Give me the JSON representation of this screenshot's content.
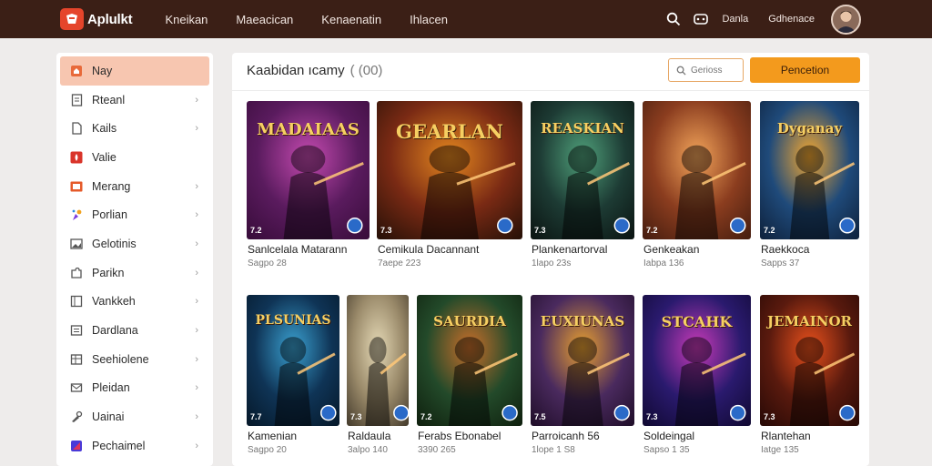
{
  "app": {
    "name": "Aplulkt",
    "colors": {
      "topbar": "#3b1f16",
      "accent": "#f39a1d",
      "brand": "#e5452b",
      "active_bg": "#f7c6b0"
    }
  },
  "nav": {
    "items": [
      "Kneikan",
      "Maeacican",
      "Kenaenatin",
      "Ihlacen"
    ]
  },
  "header": {
    "links": [
      "Danla",
      "Gdhenace"
    ],
    "icons": [
      "search-icon",
      "gamepad-icon"
    ]
  },
  "sidebar": {
    "items": [
      {
        "label": "Nay",
        "icon": "home-icon",
        "chevron": false,
        "active": true
      },
      {
        "label": "Rteanl",
        "icon": "doc-icon",
        "chevron": true
      },
      {
        "label": "Kails",
        "icon": "file-icon",
        "chevron": true
      },
      {
        "label": "Valie",
        "icon": "flame-icon",
        "chevron": false
      },
      {
        "label": "Merang",
        "icon": "grid-icon",
        "chevron": true
      },
      {
        "label": "Porlian",
        "icon": "sparkle-icon",
        "chevron": true
      },
      {
        "label": "Gelotinis",
        "icon": "image-icon",
        "chevron": true
      },
      {
        "label": "Parikn",
        "icon": "puzzle-icon",
        "chevron": true
      },
      {
        "label": "Vankkeh",
        "icon": "box-icon",
        "chevron": true
      },
      {
        "label": "Dardlana",
        "icon": "list-icon",
        "chevron": true
      },
      {
        "label": "Seehiolene",
        "icon": "table-icon",
        "chevron": true
      },
      {
        "label": "Pleidan",
        "icon": "mail-icon",
        "chevron": true
      },
      {
        "label": "Uainai",
        "icon": "tool-icon",
        "chevron": true
      },
      {
        "label": "Pechaimel",
        "icon": "palette-icon",
        "chevron": true
      }
    ],
    "chevron_glyph": "›"
  },
  "main": {
    "title": "Kaabidan ıcamy",
    "count": "( (00)",
    "search_placeholder": "Gerioss",
    "button_label": "Pencetion"
  },
  "cards": [
    {
      "title": "Sanlcelala Matarann",
      "sub": "Sagpo 28",
      "rating": "7.2",
      "art_title": "MADAIAAS",
      "theme": [
        "#5a1b5e",
        "#c44ab0",
        "#3a0d3c"
      ]
    },
    {
      "title": "Cemikula Dacannant",
      "sub": "7aepe 223",
      "rating": "7.3",
      "art_title": "GEARLAN",
      "theme": [
        "#7a2a14",
        "#e4871f",
        "#2b1208"
      ]
    },
    {
      "title": "Plankenartorval",
      "sub": "1lapo 23s",
      "rating": "7.3",
      "art_title": "REASKIAN",
      "theme": [
        "#1d3b34",
        "#4fa07a",
        "#0c1714"
      ]
    },
    {
      "title": "Genkeakan",
      "sub": "Iabpa 136",
      "rating": "7.2",
      "art_title": "",
      "theme": [
        "#8b3d1f",
        "#f2a45a",
        "#4a1f10"
      ]
    },
    {
      "title": "Raekkoca",
      "sub": "Sapps 37",
      "rating": "7.2",
      "art_title": "Dyganay",
      "theme": [
        "#1f4a7a",
        "#f5a830",
        "#0f2440"
      ]
    },
    {
      "title": "Kamenian",
      "sub": "Sagpo 20",
      "rating": "7.7",
      "art_title": "PLSUNIAS",
      "theme": [
        "#0f3456",
        "#3aa0d0",
        "#061a2c"
      ]
    },
    {
      "title": "Raldaula",
      "sub": "3alpo 140",
      "rating": "7.3",
      "art_title": "",
      "theme": [
        "#9a8a6a",
        "#e4d8b5",
        "#4a4030"
      ]
    },
    {
      "title": "Ferabs Ebonabel",
      "sub": "3390 265",
      "rating": "7.2",
      "art_title": "SAURDIA",
      "theme": [
        "#234a2a",
        "#c86e2a",
        "#10220f"
      ]
    },
    {
      "title": "Parroicanh 56",
      "sub": "1lope 1 S8",
      "rating": "7.5",
      "art_title": "EUXIUNAS",
      "theme": [
        "#4a2a5e",
        "#e8a030",
        "#220f2c"
      ]
    },
    {
      "title": "Soldeingal",
      "sub": "Sapso 1 35",
      "rating": "7.3",
      "art_title": "STCAHK",
      "theme": [
        "#2a1a6e",
        "#c73ab8",
        "#120a36"
      ]
    },
    {
      "title": "Rlantehan",
      "sub": "Iatge 135",
      "rating": "7.3",
      "art_title": "JEMAINOR",
      "theme": [
        "#5a1a0e",
        "#e8501c",
        "#2a0a06"
      ]
    }
  ]
}
